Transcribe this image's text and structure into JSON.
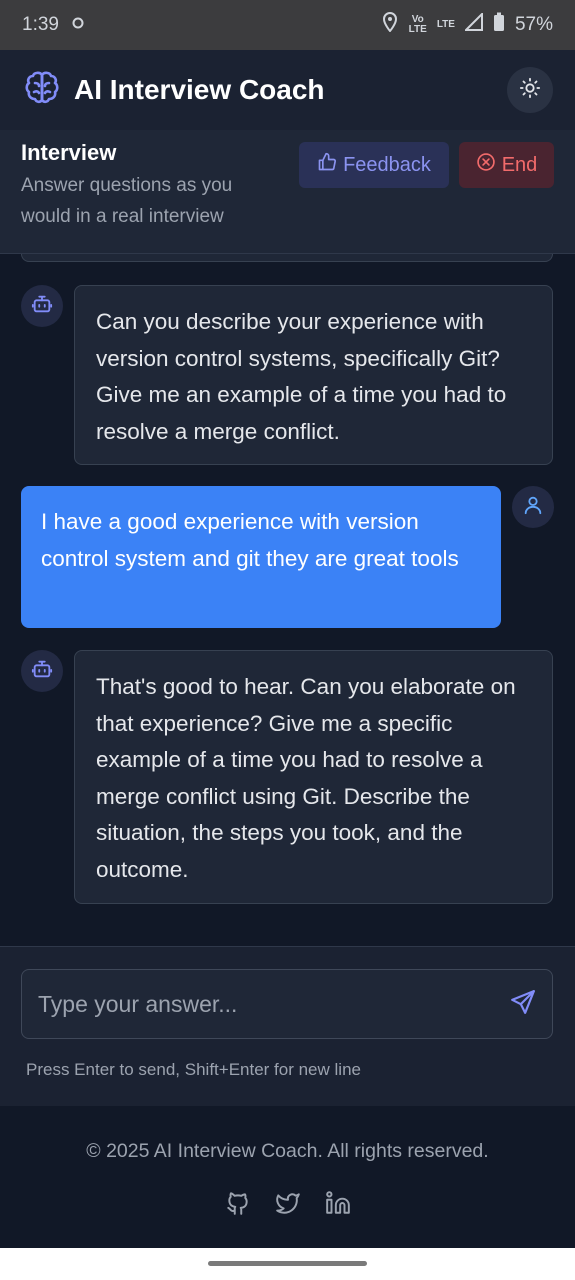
{
  "status_bar": {
    "time": "1:39",
    "network_top": "Vo",
    "network_bottom": "LTE",
    "lte": "LTE",
    "battery": "57%"
  },
  "header": {
    "title": "AI Interview Coach",
    "theme_toggle_icon": "sun-icon"
  },
  "interview": {
    "title": "Interview",
    "subtitle": "Answer questions as you would in a real interview",
    "feedback_label": "Feedback",
    "end_label": "End"
  },
  "messages": [
    {
      "role": "bot",
      "text": "Can you describe your experience with version control systems, specifically Git? Give me an example of a time you had to resolve a merge conflict."
    },
    {
      "role": "user",
      "text": "I have a good experience with version control system and git they are great tools"
    },
    {
      "role": "bot",
      "text": "That's good to hear. Can you elaborate on that experience? Give me a specific example of a time you had to resolve a merge conflict using Git. Describe the situation, the steps you took, and the outcome."
    }
  ],
  "composer": {
    "placeholder": "Type your answer...",
    "hint": "Press Enter to send, Shift+Enter for new line"
  },
  "footer": {
    "copyright": "© 2025 AI Interview Coach. All rights reserved.",
    "socials": [
      "github-icon",
      "twitter-icon",
      "linkedin-icon"
    ]
  },
  "colors": {
    "accent": "#3b82f6",
    "brand_icon": "#818cf8",
    "end": "#f26b6b",
    "background": "#111827"
  }
}
